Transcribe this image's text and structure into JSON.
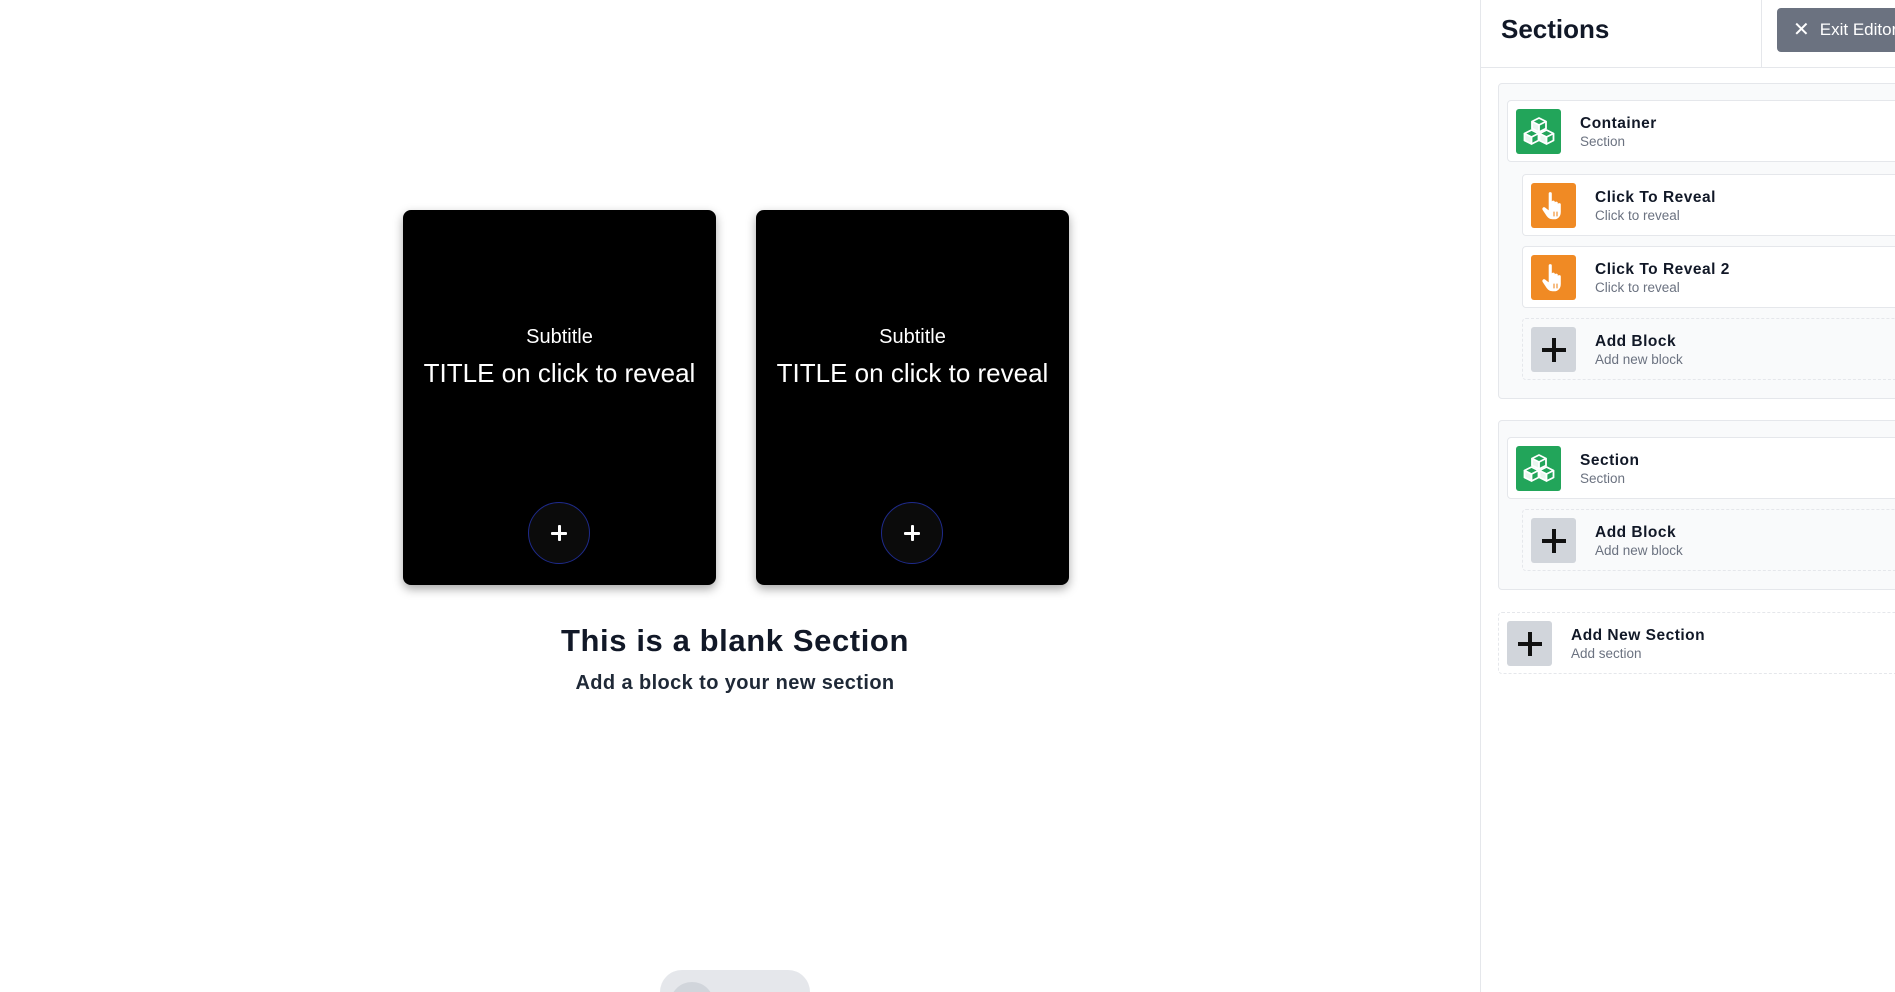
{
  "canvas": {
    "cards": [
      {
        "subtitle": "Subtitle",
        "title": "TITLE on click to reveal",
        "icon": "plus-icon"
      },
      {
        "subtitle": "Subtitle",
        "title": "TITLE on click to reveal",
        "icon": "plus-icon"
      }
    ],
    "blank_heading": "This is a blank Section",
    "blank_subheading": "Add a block to your new section"
  },
  "sidebar": {
    "title": "Sections",
    "exit_label": "Exit Editor",
    "exit_icon": "close-icon",
    "groups": [
      {
        "section": {
          "label": "Container",
          "sub": "Section",
          "icon": "cubes-icon"
        },
        "blocks": [
          {
            "label": "Click To Reveal",
            "sub": "Click to reveal",
            "icon": "hand-pointer-icon"
          },
          {
            "label": "Click To Reveal 2",
            "sub": "Click to reveal",
            "icon": "hand-pointer-icon"
          }
        ],
        "add_block": {
          "label": "Add Block",
          "sub": "Add new block",
          "icon": "plus-icon"
        }
      },
      {
        "section": {
          "label": "Section",
          "sub": "Section",
          "icon": "cubes-icon"
        },
        "blocks": [],
        "add_block": {
          "label": "Add Block",
          "sub": "Add new block",
          "icon": "plus-icon"
        }
      }
    ],
    "add_section": {
      "label": "Add New Section",
      "sub": "Add section",
      "icon": "plus-icon"
    }
  },
  "colors": {
    "section_icon": "#22a55a",
    "block_icon": "#f08a24",
    "add_icon": "#d1d5db",
    "exit_button": "#6b7280",
    "card_background": "#000000"
  }
}
